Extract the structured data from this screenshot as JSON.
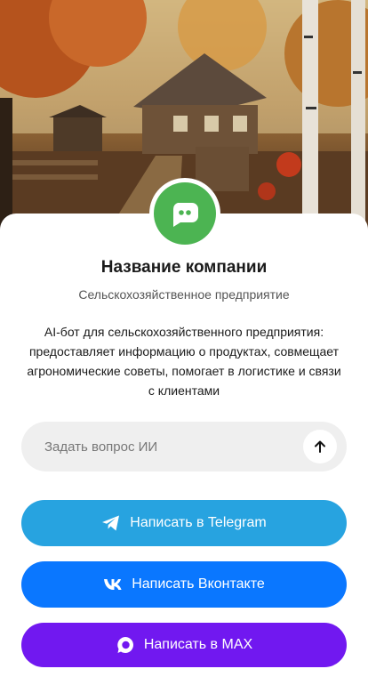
{
  "company": {
    "name": "Название компании",
    "subtitle": "Сельскохозяйственное предприятие",
    "description": "AI-бот для сельскохозяйственного предприятия: предоставляет информацию о продуктах, совмещает агрономические советы, помогает в логистике и связи с клиентами"
  },
  "ask": {
    "placeholder": "Задать вопрос ИИ"
  },
  "buttons": {
    "telegram": "Написать в Telegram",
    "vk": "Написать Вконтакте",
    "max": "Написать в MAX"
  },
  "colors": {
    "avatar": "#4cb452",
    "telegram": "#27a3e0",
    "vk": "#0a77ff",
    "max": "#7118f0"
  },
  "icons": {
    "avatar": "chat-bot-icon",
    "send": "arrow-up-icon",
    "telegram": "telegram-icon",
    "vk": "vk-icon",
    "max": "max-icon"
  }
}
